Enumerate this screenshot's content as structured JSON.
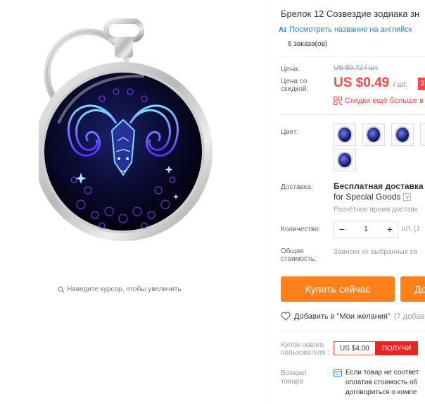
{
  "gallery": {
    "zoom_hint": "Наведите курсор, чтобы увеличить"
  },
  "product": {
    "title": "Брелок 12 Созвездие зодиака зн",
    "translate_badge": "Aɪ",
    "translate_link": "Посмотреть название на английск",
    "orders": "6 заказа(ов)"
  },
  "price": {
    "label": "Цена:",
    "old": "US $0.72 / шт.",
    "discount_label": "Цена со скидкой:",
    "new": "US $0.49",
    "per_unit": "/ шт.",
    "badge": "3",
    "discount_more": "Скидки ещё больше в"
  },
  "color": {
    "label": "Цвет:",
    "swatch_count": 5
  },
  "shipping": {
    "label": "Доставка:",
    "title": "Бесплатная доставка в",
    "sub": "for Special Goods",
    "caret": "∨",
    "estimate": "Расчётное время доставк"
  },
  "quantity": {
    "label": "Количество:",
    "minus": "−",
    "value": "1",
    "plus": "+",
    "unit": "шт. (1"
  },
  "total": {
    "label": "Общая стоимость:",
    "value": "Зависит от выбранных ха"
  },
  "actions": {
    "buy_now": "Купить сейчас",
    "add_to_cart": "До",
    "wishlist": "Добавить в \"Мои желания\"",
    "wishlist_count": "(7 добав"
  },
  "coupon": {
    "label": "Купон нового пользователя :",
    "value": "US $4.00",
    "get": "ПОЛУЧИ"
  },
  "returns": {
    "label": "Возврат товара",
    "line1": "Если товар не соответ",
    "line2": "оплатив стоимость об",
    "line3": "договориться о компе"
  },
  "colors": {
    "price_red": "#ff4747",
    "button_orange": "#ff7f1b",
    "link_blue": "#2e7de1"
  }
}
